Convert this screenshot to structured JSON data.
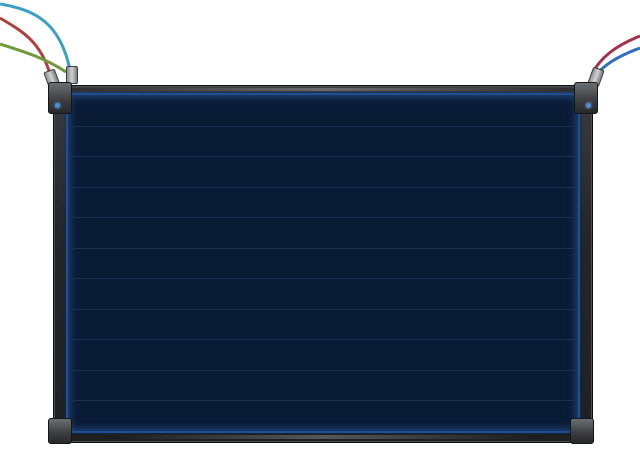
{
  "panel": {
    "screen_color": "#0a1b36",
    "screen_border_color": "#1f4f95",
    "scanline_color": "#1a3051",
    "frame_color": "#2a2c2e"
  },
  "cables": {
    "left": [
      {
        "name": "red-cable",
        "color": "#b0403c"
      },
      {
        "name": "blue-cable",
        "color": "#3ba0c8"
      },
      {
        "name": "green-cable",
        "color": "#6e9a3a"
      }
    ],
    "right": [
      {
        "name": "red-cable",
        "color": "#a5304a"
      },
      {
        "name": "blue-cable",
        "color": "#2f6fc0"
      }
    ]
  },
  "icons": [
    "cable-icon",
    "connector-icon",
    "bracket-icon",
    "led-icon"
  ]
}
